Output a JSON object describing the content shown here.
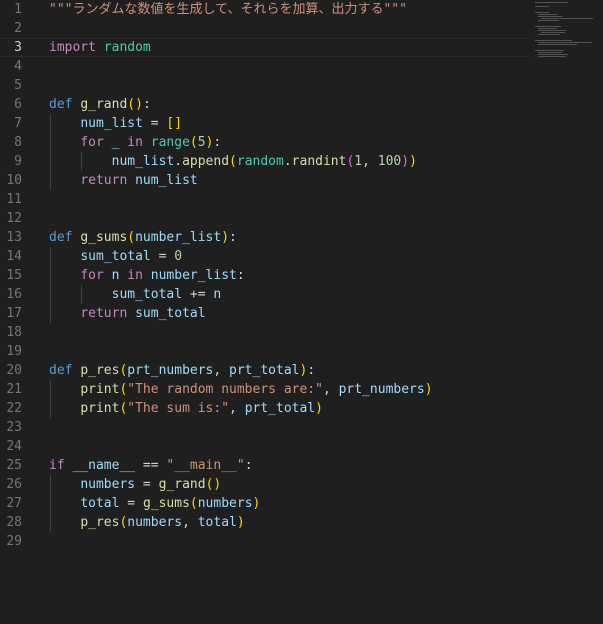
{
  "editor": {
    "language": "python",
    "current_line": 3,
    "lines": [
      {
        "n": "1",
        "indent": 0,
        "tokens": [
          {
            "c": "str",
            "t": "\"\"\"ランダムな数値を生成して、それらを加算、出力する\"\"\""
          }
        ]
      },
      {
        "n": "2",
        "indent": 0,
        "tokens": []
      },
      {
        "n": "3",
        "indent": 0,
        "tokens": [
          {
            "c": "ctl",
            "t": "import"
          },
          {
            "c": "op",
            "t": " "
          },
          {
            "c": "mod",
            "t": "random"
          }
        ]
      },
      {
        "n": "4",
        "indent": 0,
        "tokens": []
      },
      {
        "n": "5",
        "indent": 0,
        "tokens": []
      },
      {
        "n": "6",
        "indent": 0,
        "tokens": [
          {
            "c": "kw",
            "t": "def"
          },
          {
            "c": "op",
            "t": " "
          },
          {
            "c": "fn",
            "t": "g_rand"
          },
          {
            "c": "b1",
            "t": "()"
          },
          {
            "c": "op",
            "t": ":"
          }
        ]
      },
      {
        "n": "7",
        "indent": 1,
        "tokens": [
          {
            "c": "var",
            "t": "num_list"
          },
          {
            "c": "op",
            "t": " = "
          },
          {
            "c": "b1",
            "t": "[]"
          }
        ]
      },
      {
        "n": "8",
        "indent": 1,
        "tokens": [
          {
            "c": "ctl",
            "t": "for"
          },
          {
            "c": "op",
            "t": " "
          },
          {
            "c": "var",
            "t": "_"
          },
          {
            "c": "op",
            "t": " "
          },
          {
            "c": "ctl",
            "t": "in"
          },
          {
            "c": "op",
            "t": " "
          },
          {
            "c": "mod",
            "t": "range"
          },
          {
            "c": "b1",
            "t": "("
          },
          {
            "c": "num",
            "t": "5"
          },
          {
            "c": "b1",
            "t": ")"
          },
          {
            "c": "op",
            "t": ":"
          }
        ]
      },
      {
        "n": "9",
        "indent": 2,
        "tokens": [
          {
            "c": "var",
            "t": "num_list"
          },
          {
            "c": "op",
            "t": "."
          },
          {
            "c": "fn",
            "t": "append"
          },
          {
            "c": "b1",
            "t": "("
          },
          {
            "c": "mod",
            "t": "random"
          },
          {
            "c": "op",
            "t": "."
          },
          {
            "c": "fn",
            "t": "randint"
          },
          {
            "c": "b2",
            "t": "("
          },
          {
            "c": "num",
            "t": "1"
          },
          {
            "c": "op",
            "t": ", "
          },
          {
            "c": "num",
            "t": "100"
          },
          {
            "c": "b2",
            "t": ")"
          },
          {
            "c": "b1",
            "t": ")"
          }
        ]
      },
      {
        "n": "10",
        "indent": 1,
        "tokens": [
          {
            "c": "ctl",
            "t": "return"
          },
          {
            "c": "op",
            "t": " "
          },
          {
            "c": "var",
            "t": "num_list"
          }
        ]
      },
      {
        "n": "11",
        "indent": 0,
        "tokens": []
      },
      {
        "n": "12",
        "indent": 0,
        "tokens": []
      },
      {
        "n": "13",
        "indent": 0,
        "tokens": [
          {
            "c": "kw",
            "t": "def"
          },
          {
            "c": "op",
            "t": " "
          },
          {
            "c": "fn",
            "t": "g_sums"
          },
          {
            "c": "b1",
            "t": "("
          },
          {
            "c": "var",
            "t": "number_list"
          },
          {
            "c": "b1",
            "t": ")"
          },
          {
            "c": "op",
            "t": ":"
          }
        ]
      },
      {
        "n": "14",
        "indent": 1,
        "tokens": [
          {
            "c": "var",
            "t": "sum_total"
          },
          {
            "c": "op",
            "t": " = "
          },
          {
            "c": "num",
            "t": "0"
          }
        ]
      },
      {
        "n": "15",
        "indent": 1,
        "tokens": [
          {
            "c": "ctl",
            "t": "for"
          },
          {
            "c": "op",
            "t": " "
          },
          {
            "c": "var",
            "t": "n"
          },
          {
            "c": "op",
            "t": " "
          },
          {
            "c": "ctl",
            "t": "in"
          },
          {
            "c": "op",
            "t": " "
          },
          {
            "c": "var",
            "t": "number_list"
          },
          {
            "c": "op",
            "t": ":"
          }
        ]
      },
      {
        "n": "16",
        "indent": 2,
        "tokens": [
          {
            "c": "var",
            "t": "sum_total"
          },
          {
            "c": "op",
            "t": " += "
          },
          {
            "c": "var",
            "t": "n"
          }
        ]
      },
      {
        "n": "17",
        "indent": 1,
        "tokens": [
          {
            "c": "ctl",
            "t": "return"
          },
          {
            "c": "op",
            "t": " "
          },
          {
            "c": "var",
            "t": "sum_total"
          }
        ]
      },
      {
        "n": "18",
        "indent": 0,
        "tokens": []
      },
      {
        "n": "19",
        "indent": 0,
        "tokens": []
      },
      {
        "n": "20",
        "indent": 0,
        "tokens": [
          {
            "c": "kw",
            "t": "def"
          },
          {
            "c": "op",
            "t": " "
          },
          {
            "c": "fn",
            "t": "p_res"
          },
          {
            "c": "b1",
            "t": "("
          },
          {
            "c": "var",
            "t": "prt_numbers"
          },
          {
            "c": "op",
            "t": ", "
          },
          {
            "c": "var",
            "t": "prt_total"
          },
          {
            "c": "b1",
            "t": ")"
          },
          {
            "c": "op",
            "t": ":"
          }
        ]
      },
      {
        "n": "21",
        "indent": 1,
        "tokens": [
          {
            "c": "fn",
            "t": "print"
          },
          {
            "c": "b1",
            "t": "("
          },
          {
            "c": "str",
            "t": "\"The random numbers are:\""
          },
          {
            "c": "op",
            "t": ", "
          },
          {
            "c": "var",
            "t": "prt_numbers"
          },
          {
            "c": "b1",
            "t": ")"
          }
        ]
      },
      {
        "n": "22",
        "indent": 1,
        "tokens": [
          {
            "c": "fn",
            "t": "print"
          },
          {
            "c": "b1",
            "t": "("
          },
          {
            "c": "str",
            "t": "\"The sum is:\""
          },
          {
            "c": "op",
            "t": ", "
          },
          {
            "c": "var",
            "t": "prt_total"
          },
          {
            "c": "b1",
            "t": ")"
          }
        ]
      },
      {
        "n": "23",
        "indent": 0,
        "tokens": []
      },
      {
        "n": "24",
        "indent": 0,
        "tokens": []
      },
      {
        "n": "25",
        "indent": 0,
        "tokens": [
          {
            "c": "ctl",
            "t": "if"
          },
          {
            "c": "op",
            "t": " "
          },
          {
            "c": "var",
            "t": "__name__"
          },
          {
            "c": "op",
            "t": " == "
          },
          {
            "c": "str",
            "t": "\"__main__\""
          },
          {
            "c": "op",
            "t": ":"
          }
        ]
      },
      {
        "n": "26",
        "indent": 1,
        "tokens": [
          {
            "c": "var",
            "t": "numbers"
          },
          {
            "c": "op",
            "t": " = "
          },
          {
            "c": "fn",
            "t": "g_rand"
          },
          {
            "c": "b1",
            "t": "()"
          }
        ]
      },
      {
        "n": "27",
        "indent": 1,
        "tokens": [
          {
            "c": "var",
            "t": "total"
          },
          {
            "c": "op",
            "t": " = "
          },
          {
            "c": "fn",
            "t": "g_sums"
          },
          {
            "c": "b1",
            "t": "("
          },
          {
            "c": "var",
            "t": "numbers"
          },
          {
            "c": "b1",
            "t": ")"
          }
        ]
      },
      {
        "n": "28",
        "indent": 1,
        "tokens": [
          {
            "c": "fn",
            "t": "p_res"
          },
          {
            "c": "b1",
            "t": "("
          },
          {
            "c": "var",
            "t": "numbers"
          },
          {
            "c": "op",
            "t": ", "
          },
          {
            "c": "var",
            "t": "total"
          },
          {
            "c": "b1",
            "t": ")"
          }
        ]
      },
      {
        "n": "29",
        "indent": 0,
        "tokens": []
      }
    ]
  },
  "colors": {
    "background": "#1f1f1f",
    "keyword": "#569cd6",
    "control": "#c586c0",
    "function": "#dcdcaa",
    "variable": "#9cdcfe",
    "string": "#ce9178",
    "number": "#b5cea8",
    "module": "#4ec9b0",
    "bracket_level_1": "#ffd700",
    "bracket_level_2": "#da70d6"
  }
}
